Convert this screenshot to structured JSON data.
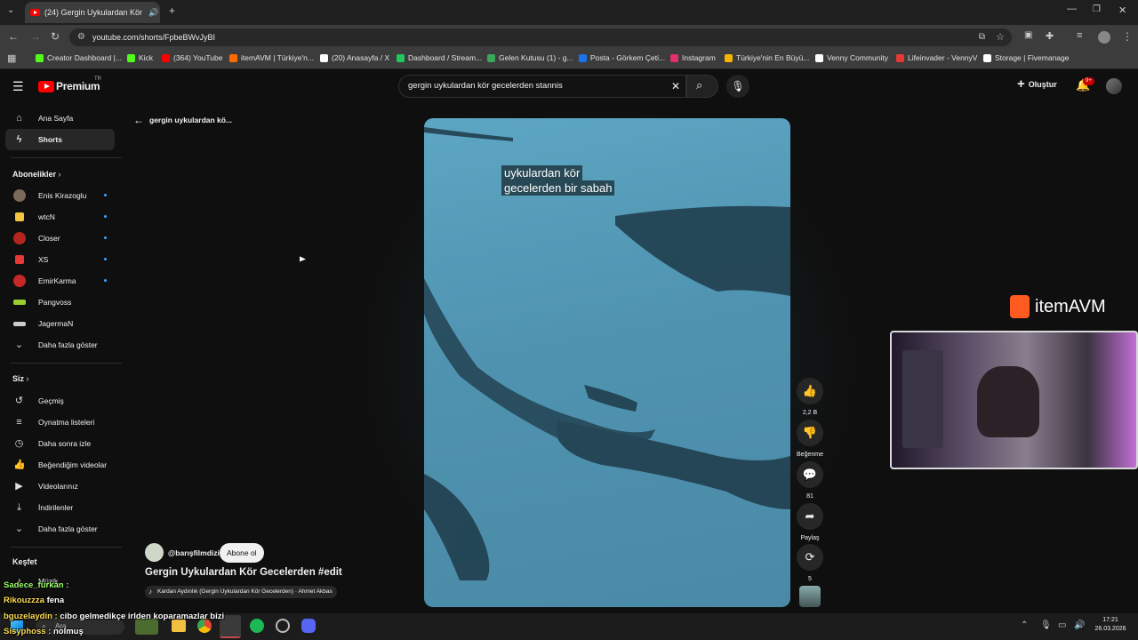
{
  "browser": {
    "tab_title": "(24) Gergin Uykulardan Kör",
    "url": "youtube.com/shorts/FpbeBWvJyBI",
    "bookmarks": [
      {
        "label": "Creator Dashboard |...",
        "color": "#53fc18"
      },
      {
        "label": "Kick",
        "color": "#53fc18"
      },
      {
        "label": "(364) YouTube",
        "color": "#ff0000"
      },
      {
        "label": "itemAVM | Türkiye'n...",
        "color": "#ff6a00"
      },
      {
        "label": "(20) Anasayfa / X",
        "color": "#ffffff"
      },
      {
        "label": "Dashboard / Stream...",
        "color": "#22c55e"
      },
      {
        "label": "Gelen Kutusu (1) - g...",
        "color": "#3aa657"
      },
      {
        "label": "Posta - Görkem Çeti...",
        "color": "#1a73e8"
      },
      {
        "label": "Instagram",
        "color": "#e1306c"
      },
      {
        "label": "Türkiye'nin En Büyü...",
        "color": "#f5b400"
      },
      {
        "label": "Venny Community",
        "color": "#ffffff"
      },
      {
        "label": "Lifeinvader - VennyV",
        "color": "#e53935"
      },
      {
        "label": "Storage | Fivemanage",
        "color": "#ffffff"
      }
    ]
  },
  "header": {
    "logo": "Premium",
    "logo_region": "TR",
    "search_value": "gergin uykulardan kör gecelerden stannis",
    "create_label": "Oluştur",
    "notif_count": "9+"
  },
  "sidebar": {
    "main": [
      {
        "label": "Ana Sayfa",
        "icon": "home-icon"
      },
      {
        "label": "Shorts",
        "icon": "shorts-icon"
      }
    ],
    "subs_title": "Abonelikler",
    "subs": [
      {
        "label": "Enis Kirazoglu",
        "color": "#7a6a5a"
      },
      {
        "label": "wtcN",
        "color": "#f5c542"
      },
      {
        "label": "Closer",
        "color": "#b3261e"
      },
      {
        "label": "XS",
        "color": "#e53935"
      },
      {
        "label": "EmirKarma",
        "color": "#c62828"
      },
      {
        "label": "Pangvoss",
        "color": "#9acd32"
      },
      {
        "label": "JagermaN",
        "color": "#cccccc"
      },
      {
        "label": "Daha fazla göster",
        "color": ""
      }
    ],
    "you_title": "Siz",
    "you": [
      {
        "label": "Geçmiş",
        "icon": "history-icon"
      },
      {
        "label": "Oynatma listeleri",
        "icon": "playlist-icon"
      },
      {
        "label": "Daha sonra izle",
        "icon": "clock-icon"
      },
      {
        "label": "Beğendiğim videolar",
        "icon": "like-icon"
      },
      {
        "label": "Videolarınız",
        "icon": "video-icon"
      },
      {
        "label": "İndirilenler",
        "icon": "download-icon"
      },
      {
        "label": "Daha fazla göster",
        "icon": "chevron-down-icon"
      }
    ],
    "explore_title": "Keşfet",
    "explore_first": "Müzik"
  },
  "short": {
    "back_label": "gergin uykulardan kö...",
    "caption_line1": "uykulardan kör",
    "caption_line2": "gecelerden bir sabah",
    "channel": "@barışfilmdizi",
    "subscribe": "Abone ol",
    "title": "Gergin Uykulardan Kör Gecelerden #edit",
    "music": "Kardan Aydınlık (Gergin Uykulardan Kör Gecelerden) · Ahmet Akbas",
    "likes": "2,2 B",
    "dislike_label": "Beğenme",
    "comments": "81",
    "share_label": "Paylaş",
    "remix_count": "5"
  },
  "overlay": {
    "sponsor": "itemAVM",
    "chat": [
      {
        "user": "Sadece_furkan :",
        "msg": ""
      },
      {
        "user": "Rikouzzza",
        "msg": "fena"
      },
      {
        "user": "bguzelaydin :",
        "msg": "cibo gelmedikçe irlden koparamazlar bizi"
      },
      {
        "user": "Sisyphoss :",
        "msg": "nolmuş"
      }
    ]
  },
  "taskbar": {
    "search_label": "Ara",
    "time": "17:21",
    "date": "26.03.2026"
  }
}
